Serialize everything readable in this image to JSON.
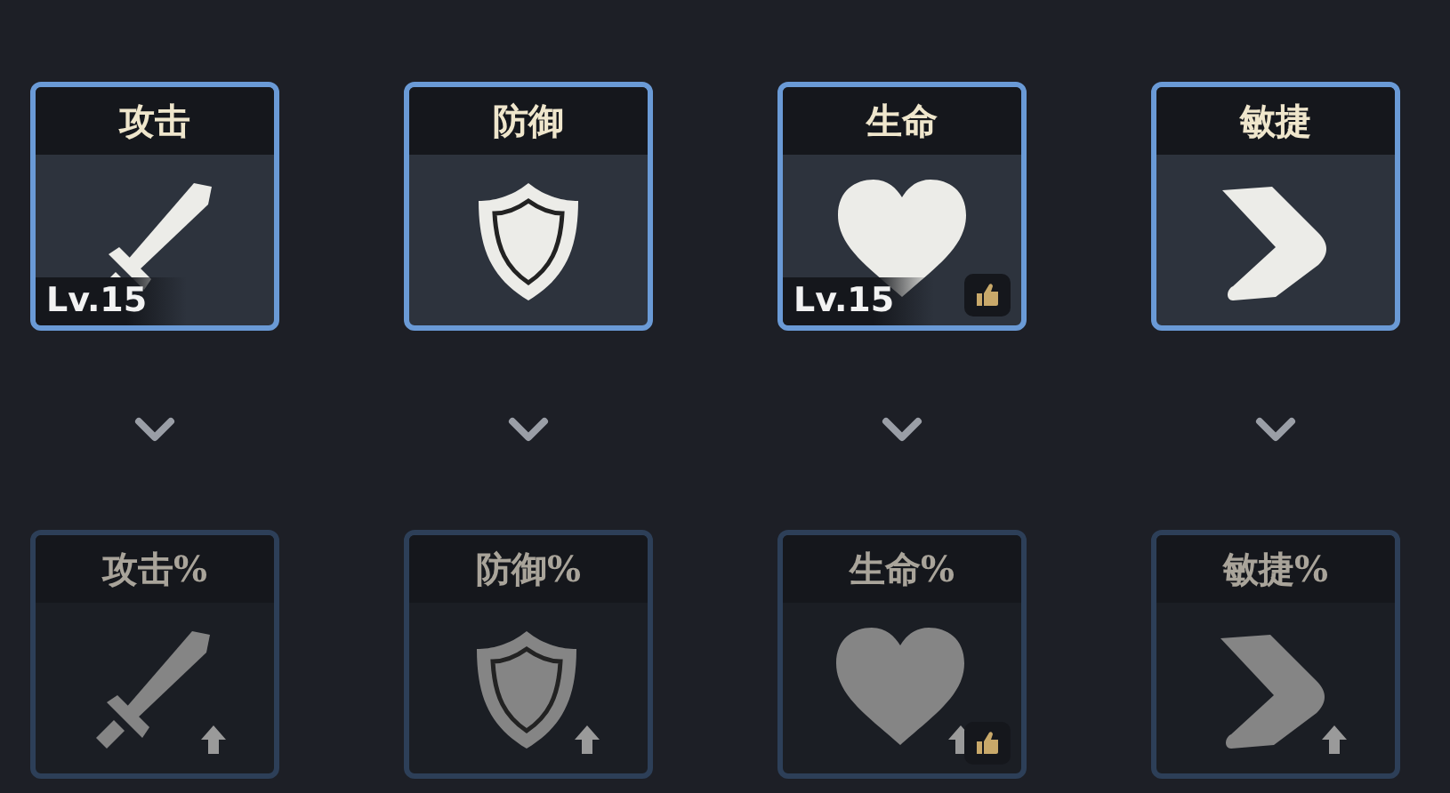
{
  "tiers": [
    {
      "active": true,
      "cards": [
        {
          "label": "攻击",
          "kind": "sword",
          "level": "Lv.15",
          "recommended": false
        },
        {
          "label": "防御",
          "kind": "shield",
          "recommended": false
        },
        {
          "label": "生命",
          "kind": "heart",
          "level": "Lv.15",
          "recommended": true
        },
        {
          "label": "敏捷",
          "kind": "boot",
          "recommended": false
        }
      ]
    },
    {
      "active": false,
      "cards": [
        {
          "label": "攻击%",
          "kind": "sword",
          "recommended": false
        },
        {
          "label": "防御%",
          "kind": "shield",
          "recommended": false
        },
        {
          "label": "生命%",
          "kind": "heart",
          "recommended": true
        },
        {
          "label": "敏捷%",
          "kind": "boot",
          "recommended": false
        }
      ]
    }
  ]
}
